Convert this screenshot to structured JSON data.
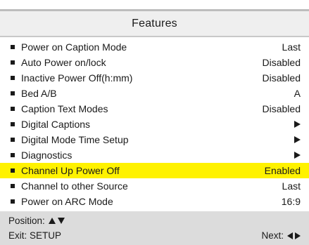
{
  "menu": {
    "title": "Features",
    "items": [
      {
        "label": "Power on Caption Mode",
        "value": "Last"
      },
      {
        "label": "Auto Power on/lock",
        "value": "Disabled"
      },
      {
        "label": "Inactive Power Off(h:mm)",
        "value": "Disabled"
      },
      {
        "label": "Bed A/B",
        "value": "A"
      },
      {
        "label": "Caption Text Modes",
        "value": "Disabled"
      },
      {
        "label": "Digital Captions",
        "value": "",
        "submenu_icon": "arrow-right-icon"
      },
      {
        "label": "Digital Mode Time Setup",
        "value": "",
        "submenu_icon": "arrow-right-icon"
      },
      {
        "label": "Diagnostics",
        "value": "",
        "submenu_icon": "arrow-right-icon"
      },
      {
        "label": "Channel Up Power Off",
        "value": "Enabled",
        "selected": true
      },
      {
        "label": "Channel to other Source",
        "value": "Last"
      },
      {
        "label": "Power on ARC Mode",
        "value": "16:9"
      }
    ]
  },
  "footer": {
    "position_label": "Position:",
    "position_icons": [
      "arrow-up-icon",
      "arrow-down-icon"
    ],
    "exit_label": "Exit: SETUP",
    "next_label": "Next:",
    "next_icons": [
      "arrow-left-icon",
      "arrow-right-icon"
    ]
  },
  "colors": {
    "highlight": "#fff200",
    "header_bg": "#efefef",
    "footer_bg": "#dcdcdc",
    "text": "#1a1a1a"
  }
}
